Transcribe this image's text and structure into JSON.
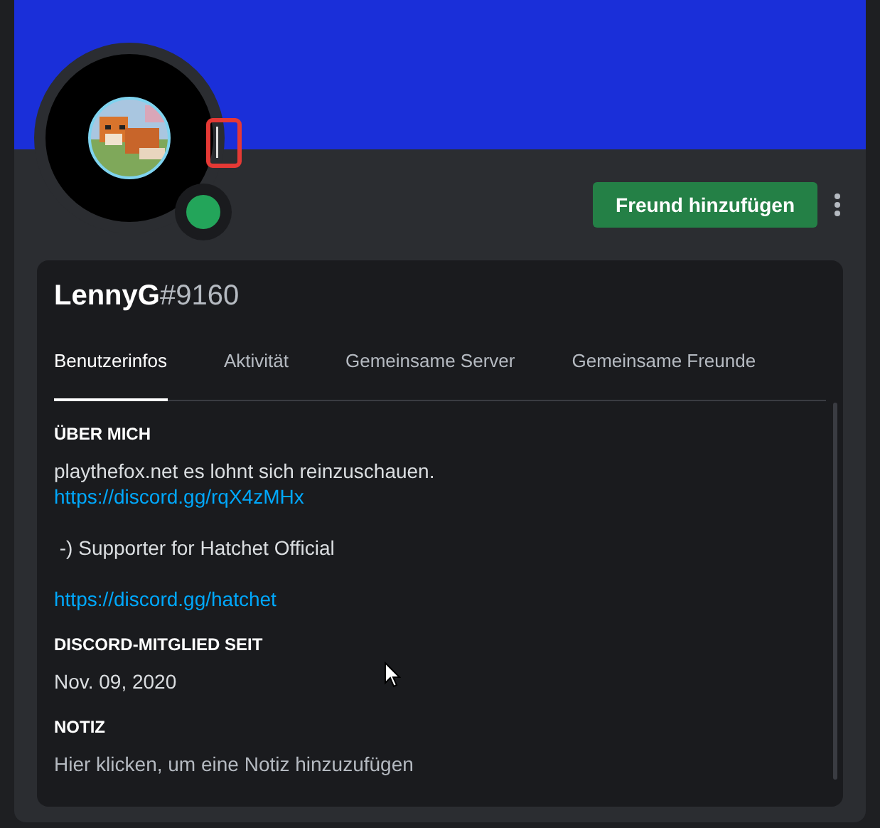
{
  "profile": {
    "online": true,
    "add_friend_button": "Freund hinzufügen",
    "username": "LennyG",
    "discriminator": "#9160"
  },
  "tabs": [
    {
      "label": "Benutzerinfos",
      "selected": true
    },
    {
      "label": "Aktivität",
      "selected": false
    },
    {
      "label": "Gemeinsame Server",
      "selected": false
    },
    {
      "label": "Gemeinsame Freunde",
      "selected": false
    }
  ],
  "sections": [
    {
      "heading": "ÜBER MICH",
      "lines": [
        {
          "kind": "text",
          "text": "playthefox.net es lohnt sich reinzuschauen."
        },
        {
          "kind": "link",
          "text": "https://discord.gg/rqX4zMHx"
        },
        {
          "kind": "blank"
        },
        {
          "kind": "text",
          "text": " -) Supporter for Hatchet Official"
        },
        {
          "kind": "blank"
        },
        {
          "kind": "link",
          "text": "https://discord.gg/hatchet"
        }
      ]
    },
    {
      "heading": "DISCORD-MITGLIED SEIT",
      "lines": [
        {
          "kind": "text",
          "text": "Nov. 09, 2020"
        }
      ]
    },
    {
      "heading": "NOTIZ",
      "lines": [
        {
          "kind": "placeholder",
          "text": "Hier klicken, um eine Notiz hinzuzufügen"
        }
      ]
    }
  ]
}
